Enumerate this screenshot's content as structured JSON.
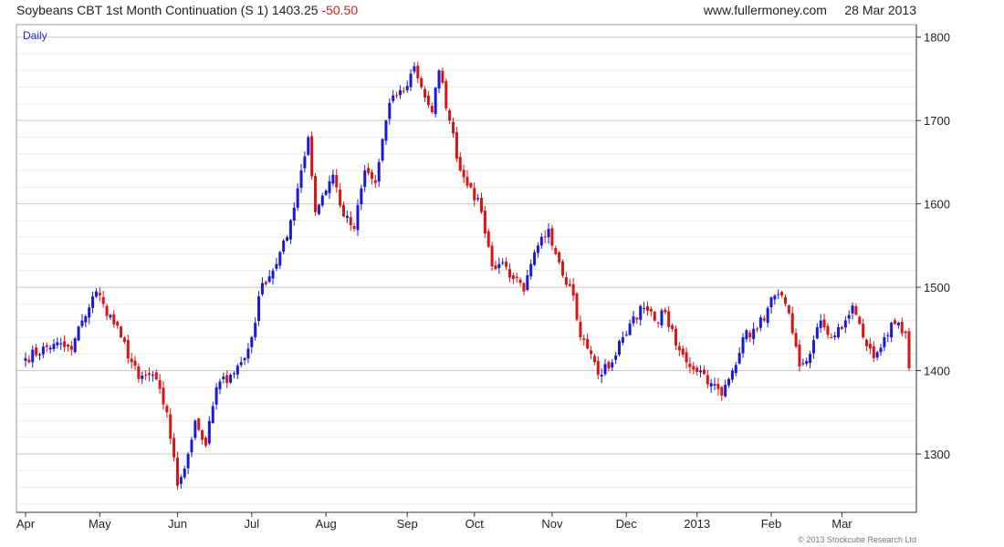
{
  "header": {
    "title": "Soybeans CBT 1st Month Continuation (S 1)",
    "last_price": "1403.25",
    "change": "-50.50",
    "website": "www.fullermoney.com",
    "date": "28 Mar 2013"
  },
  "footer": {
    "copyright": "© 2013 Stockcube Research Ltd"
  },
  "colors": {
    "up": "#1a1ad2",
    "down": "#d91414",
    "grid_major": "#c8c8c8",
    "grid_minor": "#ececec",
    "axis": "#333333"
  },
  "chart_data": {
    "type": "candlestick",
    "period_label": "Daily",
    "y_axis": {
      "side": "right",
      "min": 1230,
      "max": 1815,
      "ticks": [
        1300,
        1400,
        1500,
        1600,
        1700,
        1800
      ]
    },
    "x_axis": {
      "ticks": [
        {
          "label": "Apr",
          "day": 0
        },
        {
          "label": "May",
          "day": 21
        },
        {
          "label": "Jun",
          "day": 43
        },
        {
          "label": "Jul",
          "day": 64
        },
        {
          "label": "Aug",
          "day": 85
        },
        {
          "label": "Sep",
          "day": 108
        },
        {
          "label": "Oct",
          "day": 127
        },
        {
          "label": "Nov",
          "day": 149
        },
        {
          "label": "Dec",
          "day": 170
        },
        {
          "label": "2013",
          "day": 190
        },
        {
          "label": "Feb",
          "day": 211
        },
        {
          "label": "Mar",
          "day": 231
        }
      ],
      "days_total": 251
    },
    "grid": true,
    "keypoints": [
      [
        0,
        1415
      ],
      [
        8,
        1432
      ],
      [
        13,
        1425
      ],
      [
        16,
        1460
      ],
      [
        20,
        1495
      ],
      [
        22,
        1480
      ],
      [
        27,
        1440
      ],
      [
        32,
        1390
      ],
      [
        36,
        1395
      ],
      [
        40,
        1350
      ],
      [
        43,
        1262
      ],
      [
        46,
        1300
      ],
      [
        48,
        1340
      ],
      [
        51,
        1310
      ],
      [
        54,
        1380
      ],
      [
        58,
        1395
      ],
      [
        62,
        1415
      ],
      [
        64,
        1440
      ],
      [
        67,
        1505
      ],
      [
        70,
        1520
      ],
      [
        74,
        1560
      ],
      [
        78,
        1640
      ],
      [
        80,
        1680
      ],
      [
        82,
        1590
      ],
      [
        84,
        1610
      ],
      [
        87,
        1635
      ],
      [
        90,
        1585
      ],
      [
        93,
        1570
      ],
      [
        96,
        1640
      ],
      [
        99,
        1625
      ],
      [
        102,
        1700
      ],
      [
        104,
        1730
      ],
      [
        107,
        1735
      ],
      [
        110,
        1765
      ],
      [
        112,
        1740
      ],
      [
        115,
        1710
      ],
      [
        117,
        1760
      ],
      [
        120,
        1700
      ],
      [
        123,
        1640
      ],
      [
        126,
        1620
      ],
      [
        129,
        1590
      ],
      [
        132,
        1525
      ],
      [
        135,
        1530
      ],
      [
        138,
        1510
      ],
      [
        141,
        1495
      ],
      [
        145,
        1550
      ],
      [
        148,
        1570
      ],
      [
        151,
        1530
      ],
      [
        155,
        1490
      ],
      [
        157,
        1440
      ],
      [
        160,
        1420
      ],
      [
        162,
        1395
      ],
      [
        166,
        1410
      ],
      [
        169,
        1440
      ],
      [
        172,
        1465
      ],
      [
        175,
        1475
      ],
      [
        178,
        1460
      ],
      [
        181,
        1470
      ],
      [
        184,
        1430
      ],
      [
        187,
        1410
      ],
      [
        191,
        1400
      ],
      [
        194,
        1385
      ],
      [
        197,
        1370
      ],
      [
        200,
        1400
      ],
      [
        203,
        1440
      ],
      [
        207,
        1450
      ],
      [
        210,
        1475
      ],
      [
        212,
        1490
      ],
      [
        215,
        1480
      ],
      [
        217,
        1445
      ],
      [
        219,
        1405
      ],
      [
        222,
        1420
      ],
      [
        225,
        1460
      ],
      [
        228,
        1440
      ],
      [
        231,
        1450
      ],
      [
        234,
        1478
      ],
      [
        237,
        1440
      ],
      [
        240,
        1415
      ],
      [
        243,
        1440
      ],
      [
        246,
        1456
      ],
      [
        248,
        1445
      ],
      [
        249,
        1445
      ],
      [
        250,
        1403
      ]
    ]
  }
}
